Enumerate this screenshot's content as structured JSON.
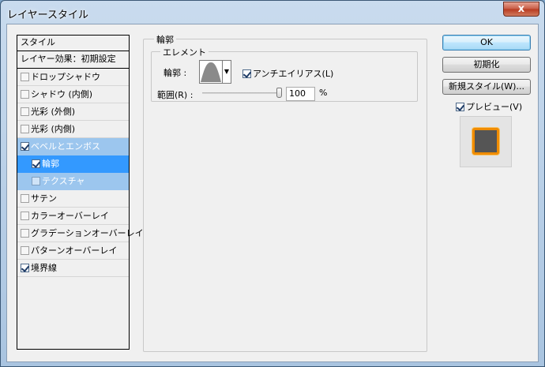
{
  "window": {
    "title": "レイヤースタイル",
    "close_label": "x"
  },
  "style_list": {
    "header": "スタイル",
    "blending": "レイヤー効果：初期設定",
    "items": [
      {
        "label": "ドロップシャドウ",
        "checked": false
      },
      {
        "label": "シャドウ (内側)",
        "checked": false
      },
      {
        "label": "光彩 (外側)",
        "checked": false
      },
      {
        "label": "光彩 (内側)",
        "checked": false
      },
      {
        "label": "ベベルとエンボス",
        "checked": true
      },
      {
        "label": "輪郭",
        "checked": true
      },
      {
        "label": "テクスチャ",
        "checked": false
      },
      {
        "label": "サテン",
        "checked": false
      },
      {
        "label": "カラーオーバーレイ",
        "checked": false
      },
      {
        "label": "グラデーションオーバーレイ",
        "checked": false
      },
      {
        "label": "パターンオーバーレイ",
        "checked": false
      },
      {
        "label": "境界線",
        "checked": true
      }
    ]
  },
  "panel": {
    "group_title": "輪郭",
    "subgroup_title": "エレメント",
    "contour_label": "輪郭 :",
    "antialias_label": "アンチエイリアス(L)",
    "antialias_checked": true,
    "range_label": "範囲(R) :",
    "range_value": "100",
    "range_unit": "%",
    "range_fraction": 1.0
  },
  "buttons": {
    "ok": "OK",
    "reset": "初期化",
    "new_style": "新規スタイル(W)...",
    "preview_label": "プレビュー(V)",
    "preview_checked": true
  },
  "colors": {
    "selection_dark": "#3399ff",
    "selection_light": "#9cc6ee",
    "preview_stroke": "#f08c00",
    "preview_fill": "#555555"
  }
}
